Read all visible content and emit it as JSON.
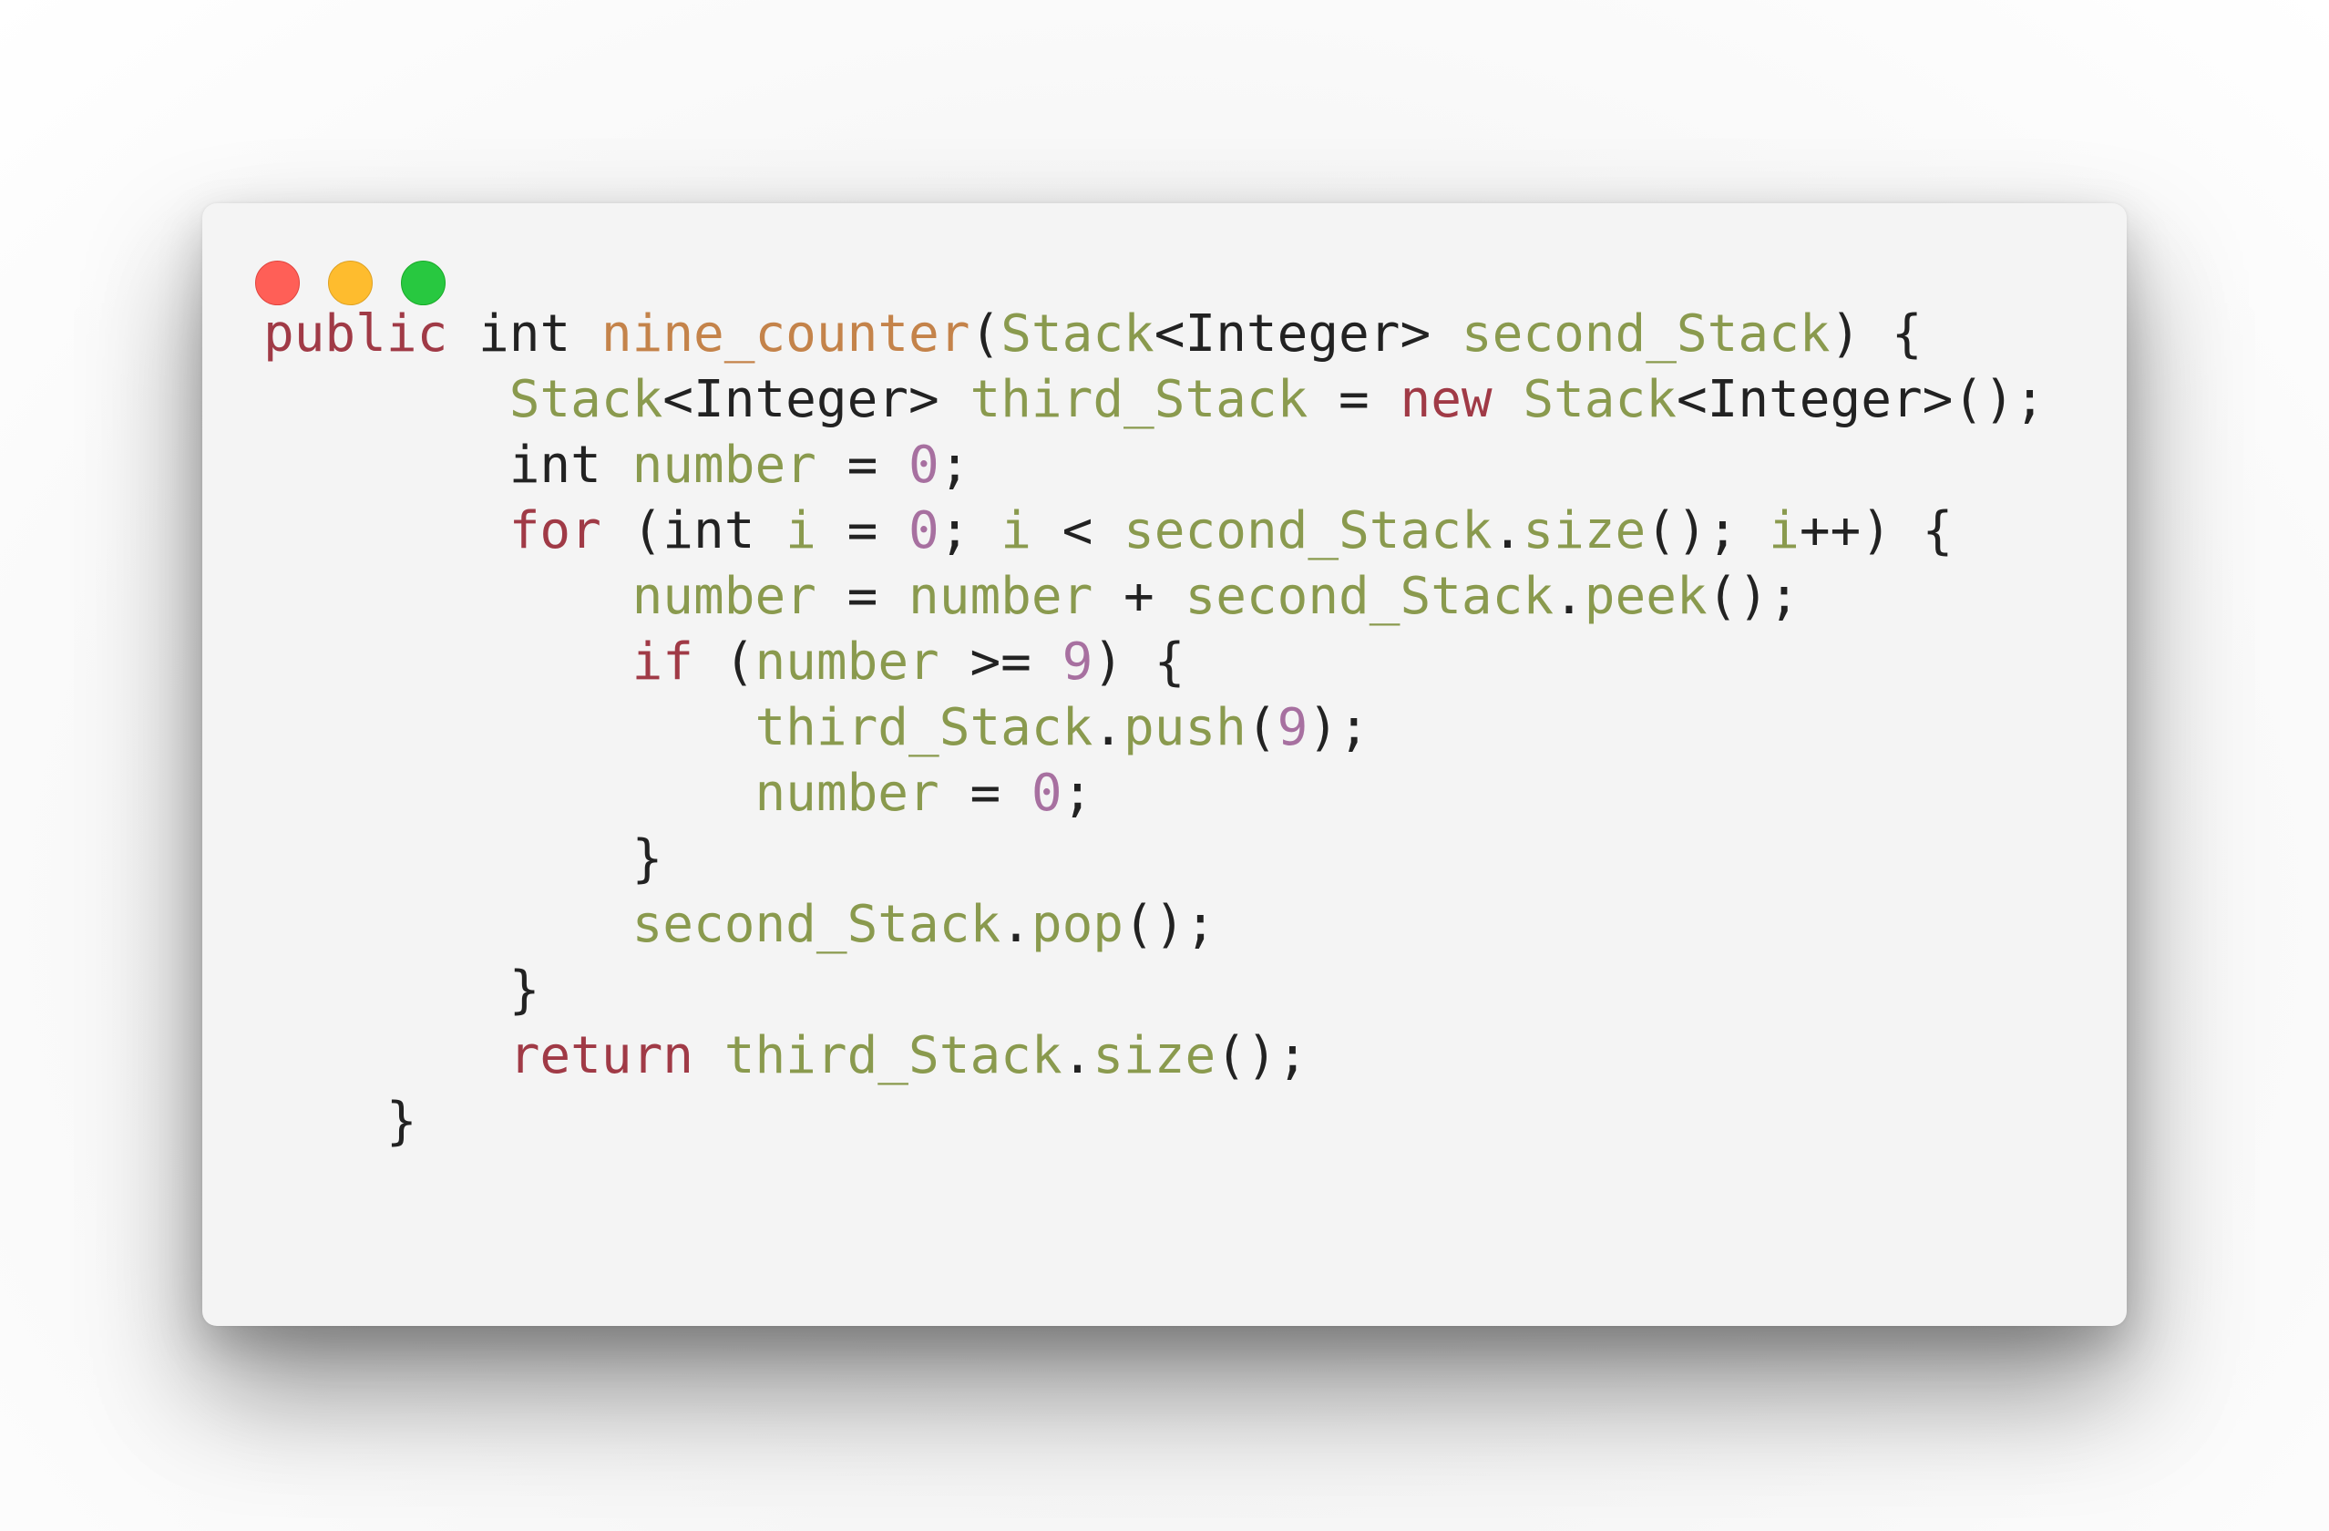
{
  "window": {
    "controls": [
      {
        "name": "close",
        "color": "#ff5f57",
        "border": "#e0443e"
      },
      {
        "name": "minimize",
        "color": "#febc2e",
        "border": "#dea123"
      },
      {
        "name": "zoom",
        "color": "#28c840",
        "border": "#1aab29"
      }
    ]
  },
  "syntax_colors": {
    "keyword": "#a03a46",
    "plain": "#222222",
    "function": "#c4834a",
    "identifier": "#8a9a4e",
    "number": "#a770a0"
  },
  "code": {
    "language": "Java",
    "lines": [
      {
        "indent": "",
        "tokens": [
          {
            "t": "public",
            "c": "keyword"
          },
          {
            "t": " ",
            "c": "plain"
          },
          {
            "t": "int",
            "c": "plain"
          },
          {
            "t": " ",
            "c": "plain"
          },
          {
            "t": "nine_counter",
            "c": "function"
          },
          {
            "t": "(",
            "c": "plain"
          },
          {
            "t": "Stack",
            "c": "identifier"
          },
          {
            "t": "<Integer> ",
            "c": "plain"
          },
          {
            "t": "second_Stack",
            "c": "identifier"
          },
          {
            "t": ") {",
            "c": "plain"
          }
        ]
      },
      {
        "indent": "        ",
        "tokens": [
          {
            "t": "Stack",
            "c": "identifier"
          },
          {
            "t": "<Integer> ",
            "c": "plain"
          },
          {
            "t": "third_Stack",
            "c": "identifier"
          },
          {
            "t": " = ",
            "c": "plain"
          },
          {
            "t": "new",
            "c": "keyword"
          },
          {
            "t": " ",
            "c": "plain"
          },
          {
            "t": "Stack",
            "c": "identifier"
          },
          {
            "t": "<Integer>();",
            "c": "plain"
          }
        ]
      },
      {
        "indent": "        ",
        "tokens": [
          {
            "t": "int",
            "c": "plain"
          },
          {
            "t": " ",
            "c": "plain"
          },
          {
            "t": "number",
            "c": "identifier"
          },
          {
            "t": " = ",
            "c": "plain"
          },
          {
            "t": "0",
            "c": "number"
          },
          {
            "t": ";",
            "c": "plain"
          }
        ]
      },
      {
        "indent": "        ",
        "tokens": [
          {
            "t": "for",
            "c": "keyword"
          },
          {
            "t": " (int ",
            "c": "plain"
          },
          {
            "t": "i",
            "c": "identifier"
          },
          {
            "t": " = ",
            "c": "plain"
          },
          {
            "t": "0",
            "c": "number"
          },
          {
            "t": "; ",
            "c": "plain"
          },
          {
            "t": "i",
            "c": "identifier"
          },
          {
            "t": " < ",
            "c": "plain"
          },
          {
            "t": "second_Stack",
            "c": "identifier"
          },
          {
            "t": ".",
            "c": "plain"
          },
          {
            "t": "size",
            "c": "identifier"
          },
          {
            "t": "(); ",
            "c": "plain"
          },
          {
            "t": "i",
            "c": "identifier"
          },
          {
            "t": "++) {",
            "c": "plain"
          }
        ]
      },
      {
        "indent": "            ",
        "tokens": [
          {
            "t": "number",
            "c": "identifier"
          },
          {
            "t": " = ",
            "c": "plain"
          },
          {
            "t": "number",
            "c": "identifier"
          },
          {
            "t": " + ",
            "c": "plain"
          },
          {
            "t": "second_Stack",
            "c": "identifier"
          },
          {
            "t": ".",
            "c": "plain"
          },
          {
            "t": "peek",
            "c": "identifier"
          },
          {
            "t": "();",
            "c": "plain"
          }
        ]
      },
      {
        "indent": "            ",
        "tokens": [
          {
            "t": "if",
            "c": "keyword"
          },
          {
            "t": " (",
            "c": "plain"
          },
          {
            "t": "number",
            "c": "identifier"
          },
          {
            "t": " >= ",
            "c": "plain"
          },
          {
            "t": "9",
            "c": "number"
          },
          {
            "t": ") {",
            "c": "plain"
          }
        ]
      },
      {
        "indent": "                ",
        "tokens": [
          {
            "t": "third_Stack",
            "c": "identifier"
          },
          {
            "t": ".",
            "c": "plain"
          },
          {
            "t": "push",
            "c": "identifier"
          },
          {
            "t": "(",
            "c": "plain"
          },
          {
            "t": "9",
            "c": "number"
          },
          {
            "t": ");",
            "c": "plain"
          }
        ]
      },
      {
        "indent": "                ",
        "tokens": [
          {
            "t": "number",
            "c": "identifier"
          },
          {
            "t": " = ",
            "c": "plain"
          },
          {
            "t": "0",
            "c": "number"
          },
          {
            "t": ";",
            "c": "plain"
          }
        ]
      },
      {
        "indent": "            ",
        "tokens": [
          {
            "t": "}",
            "c": "plain"
          }
        ]
      },
      {
        "indent": "            ",
        "tokens": [
          {
            "t": "second_Stack",
            "c": "identifier"
          },
          {
            "t": ".",
            "c": "plain"
          },
          {
            "t": "pop",
            "c": "identifier"
          },
          {
            "t": "();",
            "c": "plain"
          }
        ]
      },
      {
        "indent": "        ",
        "tokens": [
          {
            "t": "}",
            "c": "plain"
          }
        ]
      },
      {
        "indent": "        ",
        "tokens": [
          {
            "t": "return",
            "c": "keyword"
          },
          {
            "t": " ",
            "c": "plain"
          },
          {
            "t": "third_Stack",
            "c": "identifier"
          },
          {
            "t": ".",
            "c": "plain"
          },
          {
            "t": "size",
            "c": "identifier"
          },
          {
            "t": "();",
            "c": "plain"
          }
        ]
      },
      {
        "indent": "    ",
        "tokens": [
          {
            "t": "}",
            "c": "plain"
          }
        ]
      }
    ]
  }
}
